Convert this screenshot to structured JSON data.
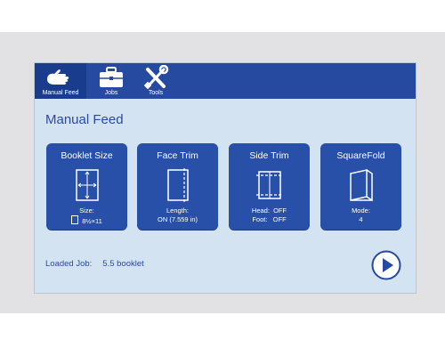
{
  "nav": {
    "tabs": [
      {
        "label": "Manual Feed",
        "icon": "hand-icon",
        "active": true
      },
      {
        "label": "Jobs",
        "icon": "briefcase-icon",
        "active": false
      },
      {
        "label": "Tools",
        "icon": "tools-icon",
        "active": false
      }
    ]
  },
  "page": {
    "title": "Manual Feed"
  },
  "tiles": [
    {
      "title": "Booklet Size",
      "line1": "Size:",
      "line2": "8½×11",
      "icon": "booklet-size-icon"
    },
    {
      "title": "Face Trim",
      "line1": "Length:",
      "line2": "ON (7.559 in)",
      "icon": "face-trim-icon"
    },
    {
      "title": "Side Trim",
      "head_label": "Head:",
      "head_value": "OFF",
      "foot_label": "Foot:",
      "foot_value": "OFF",
      "icon": "side-trim-icon"
    },
    {
      "title": "SquareFold",
      "line1": "Mode:",
      "line2": "4",
      "icon": "squarefold-icon"
    }
  ],
  "status": {
    "loaded_label": "Loaded Job:",
    "loaded_value": "5.5 booklet"
  },
  "colors": {
    "accent": "#254aa0",
    "tile": "#2850a8",
    "screen_bg": "#d4e3f2",
    "text": "#2a4aa0"
  }
}
